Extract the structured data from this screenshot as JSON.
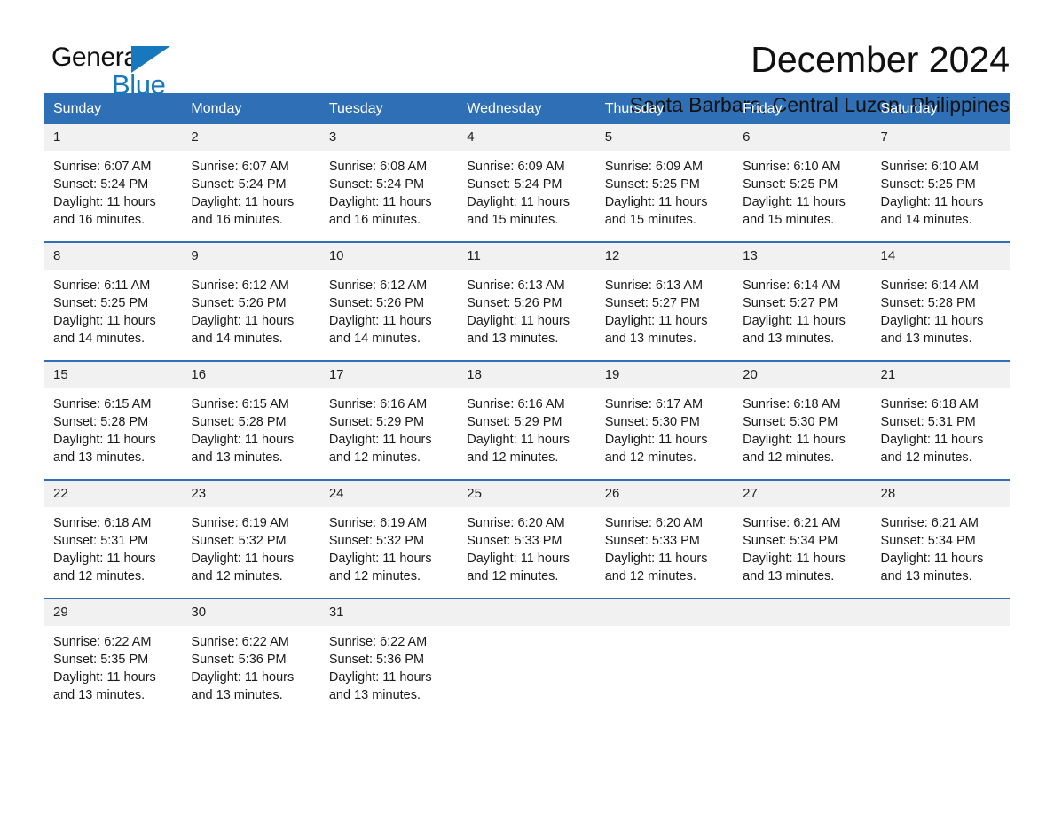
{
  "logo": {
    "word_one": "General",
    "word_two": "Blue",
    "triangle_color": "#1878be",
    "icon": "general-blue-logo"
  },
  "header": {
    "title": "December 2024",
    "location": "Santa Barbara, Central Luzon, Philippines"
  },
  "theme": {
    "header_blue": "#2e6fb5",
    "daynum_gray": "#f1f1f1",
    "text": "#1a1a1a"
  },
  "calendar": {
    "weekday_headers": [
      "Sunday",
      "Monday",
      "Tuesday",
      "Wednesday",
      "Thursday",
      "Friday",
      "Saturday"
    ],
    "weeks": [
      [
        {
          "day": "1",
          "sunrise": "Sunrise: 6:07 AM",
          "sunset": "Sunset: 5:24 PM",
          "daylight": "Daylight: 11 hours and 16 minutes."
        },
        {
          "day": "2",
          "sunrise": "Sunrise: 6:07 AM",
          "sunset": "Sunset: 5:24 PM",
          "daylight": "Daylight: 11 hours and 16 minutes."
        },
        {
          "day": "3",
          "sunrise": "Sunrise: 6:08 AM",
          "sunset": "Sunset: 5:24 PM",
          "daylight": "Daylight: 11 hours and 16 minutes."
        },
        {
          "day": "4",
          "sunrise": "Sunrise: 6:09 AM",
          "sunset": "Sunset: 5:24 PM",
          "daylight": "Daylight: 11 hours and 15 minutes."
        },
        {
          "day": "5",
          "sunrise": "Sunrise: 6:09 AM",
          "sunset": "Sunset: 5:25 PM",
          "daylight": "Daylight: 11 hours and 15 minutes."
        },
        {
          "day": "6",
          "sunrise": "Sunrise: 6:10 AM",
          "sunset": "Sunset: 5:25 PM",
          "daylight": "Daylight: 11 hours and 15 minutes."
        },
        {
          "day": "7",
          "sunrise": "Sunrise: 6:10 AM",
          "sunset": "Sunset: 5:25 PM",
          "daylight": "Daylight: 11 hours and 14 minutes."
        }
      ],
      [
        {
          "day": "8",
          "sunrise": "Sunrise: 6:11 AM",
          "sunset": "Sunset: 5:25 PM",
          "daylight": "Daylight: 11 hours and 14 minutes."
        },
        {
          "day": "9",
          "sunrise": "Sunrise: 6:12 AM",
          "sunset": "Sunset: 5:26 PM",
          "daylight": "Daylight: 11 hours and 14 minutes."
        },
        {
          "day": "10",
          "sunrise": "Sunrise: 6:12 AM",
          "sunset": "Sunset: 5:26 PM",
          "daylight": "Daylight: 11 hours and 14 minutes."
        },
        {
          "day": "11",
          "sunrise": "Sunrise: 6:13 AM",
          "sunset": "Sunset: 5:26 PM",
          "daylight": "Daylight: 11 hours and 13 minutes."
        },
        {
          "day": "12",
          "sunrise": "Sunrise: 6:13 AM",
          "sunset": "Sunset: 5:27 PM",
          "daylight": "Daylight: 11 hours and 13 minutes."
        },
        {
          "day": "13",
          "sunrise": "Sunrise: 6:14 AM",
          "sunset": "Sunset: 5:27 PM",
          "daylight": "Daylight: 11 hours and 13 minutes."
        },
        {
          "day": "14",
          "sunrise": "Sunrise: 6:14 AM",
          "sunset": "Sunset: 5:28 PM",
          "daylight": "Daylight: 11 hours and 13 minutes."
        }
      ],
      [
        {
          "day": "15",
          "sunrise": "Sunrise: 6:15 AM",
          "sunset": "Sunset: 5:28 PM",
          "daylight": "Daylight: 11 hours and 13 minutes."
        },
        {
          "day": "16",
          "sunrise": "Sunrise: 6:15 AM",
          "sunset": "Sunset: 5:28 PM",
          "daylight": "Daylight: 11 hours and 13 minutes."
        },
        {
          "day": "17",
          "sunrise": "Sunrise: 6:16 AM",
          "sunset": "Sunset: 5:29 PM",
          "daylight": "Daylight: 11 hours and 12 minutes."
        },
        {
          "day": "18",
          "sunrise": "Sunrise: 6:16 AM",
          "sunset": "Sunset: 5:29 PM",
          "daylight": "Daylight: 11 hours and 12 minutes."
        },
        {
          "day": "19",
          "sunrise": "Sunrise: 6:17 AM",
          "sunset": "Sunset: 5:30 PM",
          "daylight": "Daylight: 11 hours and 12 minutes."
        },
        {
          "day": "20",
          "sunrise": "Sunrise: 6:18 AM",
          "sunset": "Sunset: 5:30 PM",
          "daylight": "Daylight: 11 hours and 12 minutes."
        },
        {
          "day": "21",
          "sunrise": "Sunrise: 6:18 AM",
          "sunset": "Sunset: 5:31 PM",
          "daylight": "Daylight: 11 hours and 12 minutes."
        }
      ],
      [
        {
          "day": "22",
          "sunrise": "Sunrise: 6:18 AM",
          "sunset": "Sunset: 5:31 PM",
          "daylight": "Daylight: 11 hours and 12 minutes."
        },
        {
          "day": "23",
          "sunrise": "Sunrise: 6:19 AM",
          "sunset": "Sunset: 5:32 PM",
          "daylight": "Daylight: 11 hours and 12 minutes."
        },
        {
          "day": "24",
          "sunrise": "Sunrise: 6:19 AM",
          "sunset": "Sunset: 5:32 PM",
          "daylight": "Daylight: 11 hours and 12 minutes."
        },
        {
          "day": "25",
          "sunrise": "Sunrise: 6:20 AM",
          "sunset": "Sunset: 5:33 PM",
          "daylight": "Daylight: 11 hours and 12 minutes."
        },
        {
          "day": "26",
          "sunrise": "Sunrise: 6:20 AM",
          "sunset": "Sunset: 5:33 PM",
          "daylight": "Daylight: 11 hours and 12 minutes."
        },
        {
          "day": "27",
          "sunrise": "Sunrise: 6:21 AM",
          "sunset": "Sunset: 5:34 PM",
          "daylight": "Daylight: 11 hours and 13 minutes."
        },
        {
          "day": "28",
          "sunrise": "Sunrise: 6:21 AM",
          "sunset": "Sunset: 5:34 PM",
          "daylight": "Daylight: 11 hours and 13 minutes."
        }
      ],
      [
        {
          "day": "29",
          "sunrise": "Sunrise: 6:22 AM",
          "sunset": "Sunset: 5:35 PM",
          "daylight": "Daylight: 11 hours and 13 minutes."
        },
        {
          "day": "30",
          "sunrise": "Sunrise: 6:22 AM",
          "sunset": "Sunset: 5:36 PM",
          "daylight": "Daylight: 11 hours and 13 minutes."
        },
        {
          "day": "31",
          "sunrise": "Sunrise: 6:22 AM",
          "sunset": "Sunset: 5:36 PM",
          "daylight": "Daylight: 11 hours and 13 minutes."
        },
        {
          "day": "",
          "sunrise": "",
          "sunset": "",
          "daylight": ""
        },
        {
          "day": "",
          "sunrise": "",
          "sunset": "",
          "daylight": ""
        },
        {
          "day": "",
          "sunrise": "",
          "sunset": "",
          "daylight": ""
        },
        {
          "day": "",
          "sunrise": "",
          "sunset": "",
          "daylight": ""
        }
      ]
    ]
  }
}
